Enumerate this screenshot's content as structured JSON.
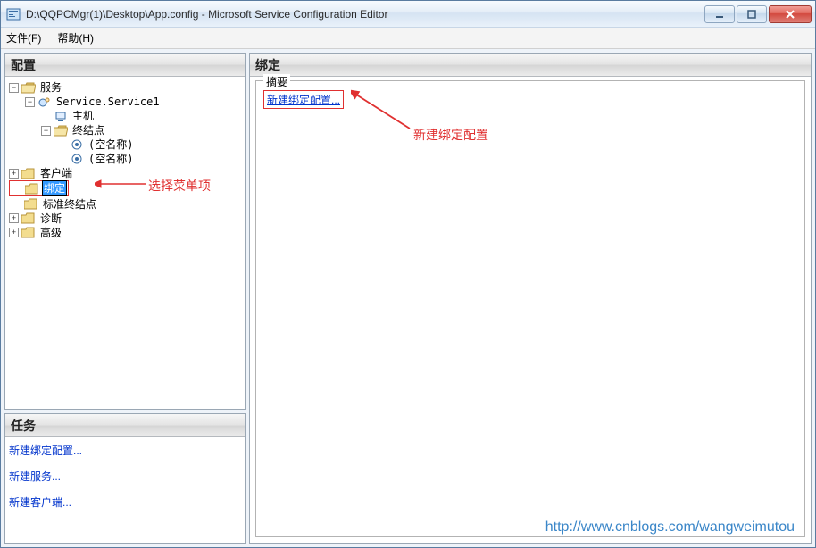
{
  "window": {
    "title": "D:\\QQPCMgr(1)\\Desktop\\App.config - Microsoft Service Configuration Editor"
  },
  "menu": {
    "file": "文件(F)",
    "help": "帮助(H)"
  },
  "left": {
    "header": "配置",
    "tree": {
      "services": "服务",
      "service1": "Service.Service1",
      "host": "主机",
      "endpoints": "终结点",
      "endpoint_empty1": "(空名称)",
      "endpoint_empty2": "(空名称)",
      "clients": "客户端",
      "bindings": "绑定",
      "std_endpoints": "标准终结点",
      "diagnostics": "诊断",
      "advanced": "高级"
    }
  },
  "tasks": {
    "header": "任务",
    "new_binding": "新建绑定配置...",
    "new_service": "新建服务...",
    "new_client": "新建客户端..."
  },
  "right": {
    "header": "绑定",
    "summary_label": "摘要",
    "new_binding_link": "新建绑定配置..."
  },
  "annotations": {
    "select_menu": "选择菜单项",
    "new_binding_cfg": "新建绑定配置"
  },
  "footer": {
    "url": "http://www.cnblogs.com/wangweimutou"
  }
}
